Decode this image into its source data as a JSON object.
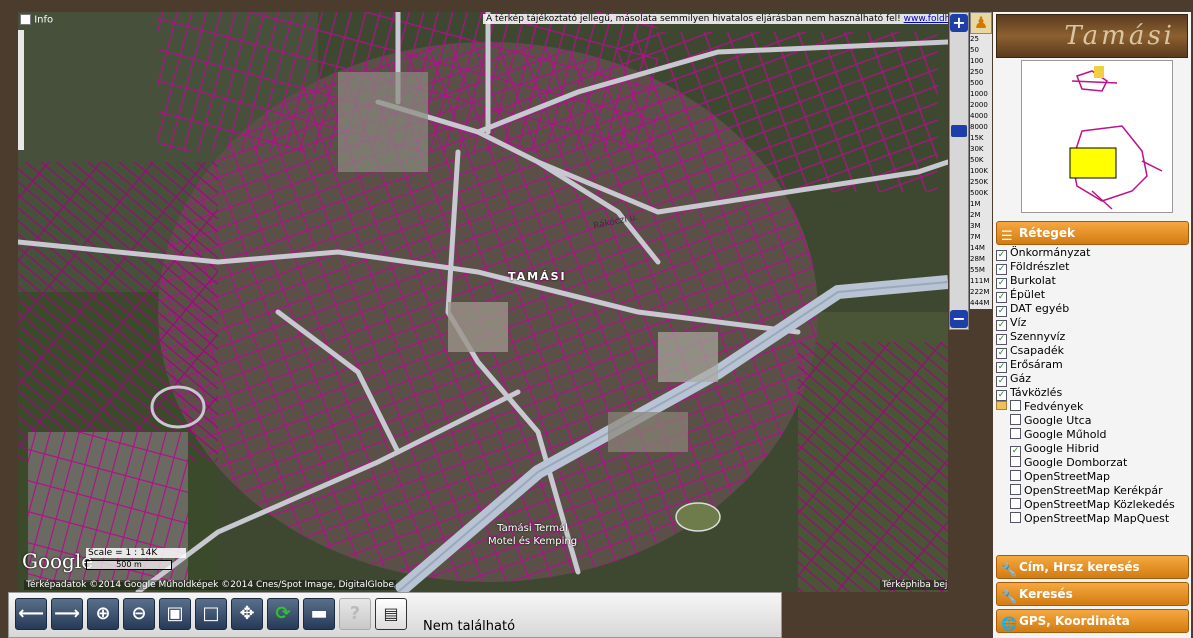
{
  "map": {
    "disclaimer": "A térkép tájékoztató jellegű, másolata semmilyen hivatalos eljárásban nem használható fel!",
    "disclaimer_link": "www.foldhivatal.hu",
    "info_label": "Info",
    "town_label": "TAMÁSI",
    "poi_label_line1": "Tamási Termál",
    "poi_label_line2": "Motel és Kemping",
    "street_label": "Rákóczi u.",
    "google_logo": "Google",
    "scale_text": "Scale = 1 : 14K",
    "scale_bar": "500 m",
    "copyright": "Térképadatok ©2014 Google Műholdképek ©2014 Cnes/Spot Image, DigitalGlobe",
    "report_error": "Térképhiba bejelentése"
  },
  "zoom": {
    "in_label": "+",
    "out_label": "−",
    "levels": [
      "25",
      "50",
      "100",
      "250",
      "500",
      "1000",
      "2000",
      "4000",
      "8000",
      "15K",
      "30K",
      "50K",
      "100K",
      "250K",
      "500K",
      "1M",
      "2M",
      "3M",
      "7M",
      "14M",
      "28M",
      "55M",
      "111M",
      "222M",
      "444M"
    ]
  },
  "sidebar": {
    "logo_text": "Tamási",
    "layers_title": "Rétegek",
    "layers": [
      {
        "label": "Önkormányzat",
        "checked": true,
        "sub": false
      },
      {
        "label": "Földrészlet",
        "checked": true,
        "sub": false
      },
      {
        "label": "Burkolat",
        "checked": true,
        "sub": false
      },
      {
        "label": "Épület",
        "checked": true,
        "sub": false
      },
      {
        "label": "DAT egyéb",
        "checked": true,
        "sub": false
      },
      {
        "label": "Víz",
        "checked": true,
        "sub": false
      },
      {
        "label": "Szennyvíz",
        "checked": true,
        "sub": false
      },
      {
        "label": "Csapadék",
        "checked": true,
        "sub": false
      },
      {
        "label": "Erősáram",
        "checked": true,
        "sub": false
      },
      {
        "label": "Gáz",
        "checked": true,
        "sub": false
      },
      {
        "label": "Távközlés",
        "checked": true,
        "sub": false
      },
      {
        "label": "Fedvények",
        "checked": false,
        "sub": false,
        "folder": true
      },
      {
        "label": "Google Utca",
        "checked": false,
        "sub": true
      },
      {
        "label": "Google Műhold",
        "checked": false,
        "sub": true
      },
      {
        "label": "Google Hibrid",
        "checked": true,
        "sub": true
      },
      {
        "label": "Google Domborzat",
        "checked": false,
        "sub": true
      },
      {
        "label": "OpenStreetMap",
        "checked": false,
        "sub": true
      },
      {
        "label": "OpenStreetMap Kerékpár",
        "checked": false,
        "sub": true
      },
      {
        "label": "OpenStreetMap Közlekedés",
        "checked": false,
        "sub": true
      },
      {
        "label": "OpenStreetMap MapQuest",
        "checked": false,
        "sub": true
      }
    ],
    "sections": [
      {
        "label": "Cím, Hrsz keresés"
      },
      {
        "label": "Keresés"
      },
      {
        "label": "GPS, Koordináta"
      }
    ]
  },
  "toolbar": {
    "status": "Nem található"
  },
  "colors": {
    "parcel": "#b0108a",
    "road": "#c8c8d0",
    "accent": "#e08a1e"
  }
}
